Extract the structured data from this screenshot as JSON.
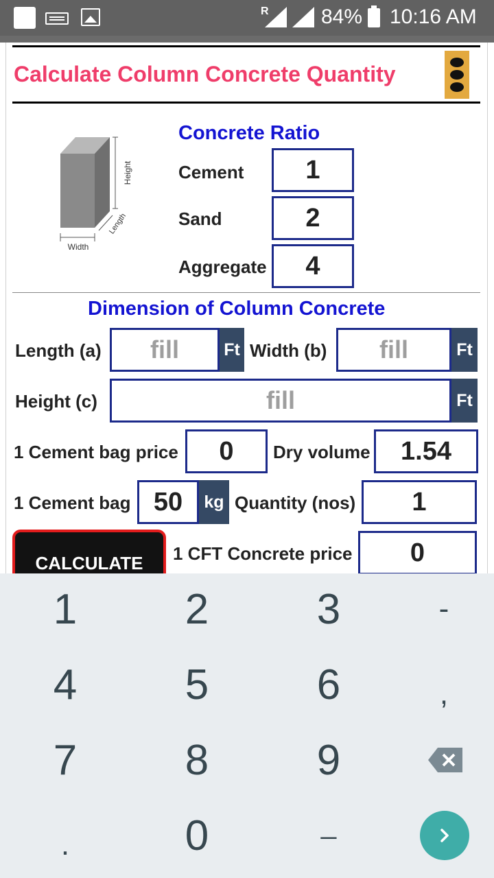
{
  "status_bar": {
    "roaming": "R",
    "battery": "84%",
    "time": "10:16 AM",
    "icons": [
      "square-icon",
      "keyboard-icon",
      "image-icon",
      "signal-icon",
      "battery-icon"
    ]
  },
  "header": {
    "title": "Calculate Column Concrete Quantity",
    "title_color": "#ef3d6a",
    "menu_icon": "overflow-menu-icon"
  },
  "illustration": {
    "height_label": "Height",
    "length_label": "Length",
    "width_label": "Width"
  },
  "ratio": {
    "heading": "Concrete Ratio",
    "cement_label": "Cement",
    "cement_value": "1",
    "sand_label": "Sand",
    "sand_value": "2",
    "aggregate_label": "Aggregate",
    "aggregate_value": "4"
  },
  "dimension": {
    "heading": "Dimension of Column Concrete",
    "length_label": "Length (a)",
    "length_placeholder": "fill",
    "length_unit": "Ft",
    "width_label": "Width (b)",
    "width_placeholder": "fill",
    "width_unit": "Ft",
    "height_label": "Height (c)",
    "height_placeholder": "fill",
    "height_unit": "Ft"
  },
  "inputs": {
    "cement_bag_price_label": "1 Cement bag price",
    "cement_bag_price_value": "0",
    "dry_volume_label": "Dry volume",
    "dry_volume_value": "1.54",
    "cement_bag_label": "1 Cement bag",
    "cement_bag_value": "50",
    "cement_bag_unit": "kg",
    "quantity_label": "Quantity (nos)",
    "quantity_value": "1",
    "cft_price_label": "1 CFT Concrete price",
    "cft_price_value": "0"
  },
  "calculate_button": "CALCULATE",
  "keyboard": {
    "row1": [
      "1",
      "2",
      "3",
      "-"
    ],
    "row2": [
      "4",
      "5",
      "6",
      ","
    ],
    "row3": [
      "7",
      "8",
      "9"
    ],
    "row4": [
      ".",
      "0",
      "_"
    ],
    "backspace_icon": "backspace-icon",
    "go_icon": "go-arrow-icon",
    "colors": {
      "background": "#e9edf0",
      "key_text": "#37474f",
      "go_button": "#3fada8"
    }
  }
}
